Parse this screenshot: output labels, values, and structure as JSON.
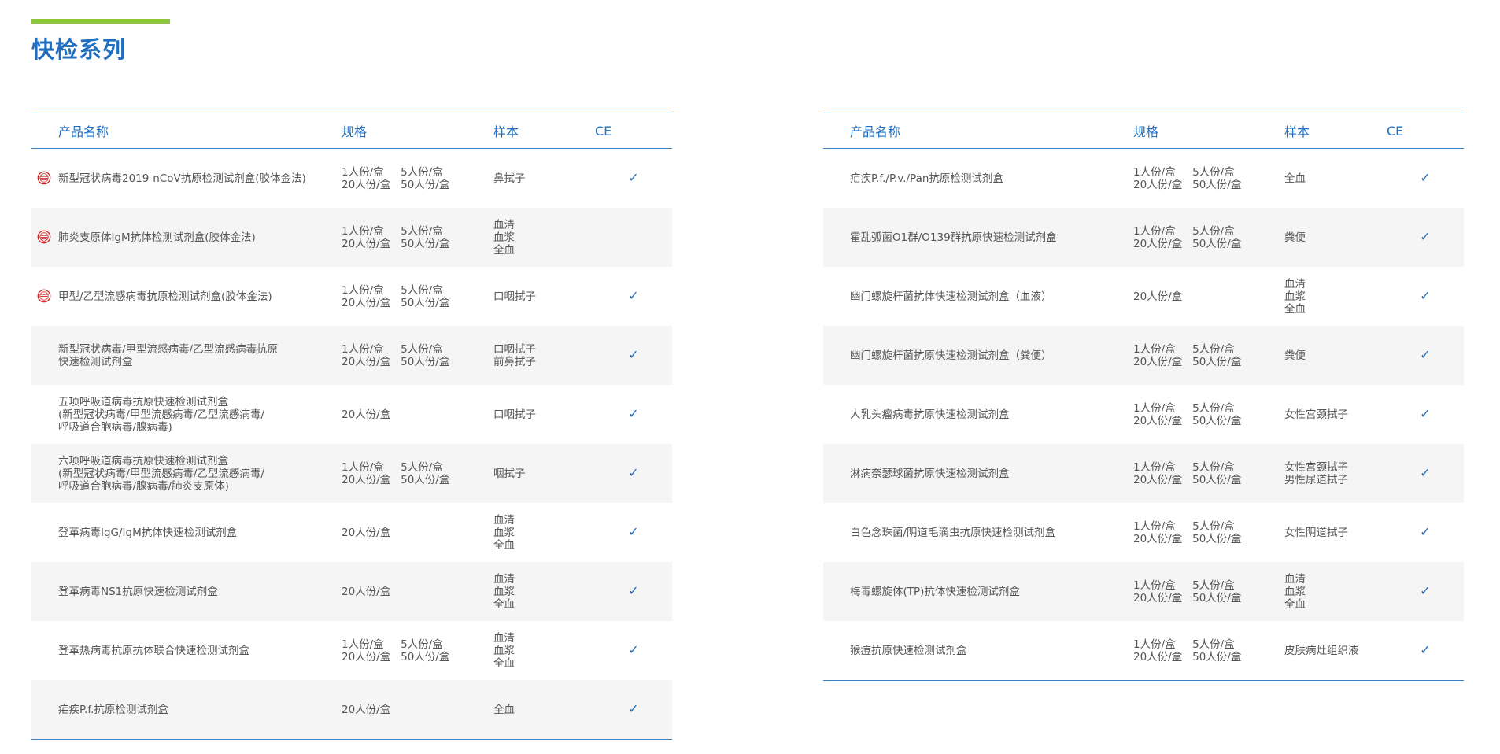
{
  "page": {
    "title": "快检系列"
  },
  "colors": {
    "accent_green": "#8cc63f",
    "accent_blue": "#1e6fc2",
    "row_alt": "#f5f5f5"
  },
  "tables": [
    {
      "headers": {
        "name": "产品名称",
        "spec": "规格",
        "sample": "样本",
        "ce": "CE"
      },
      "rows": [
        {
          "badge": true,
          "name": "新型冠状病毒2019-nCoV抗原检测试剂盒(胶体金法)",
          "spec": "1人份/盒     5人份/盒\n20人份/盒   50人份/盒",
          "sample": "鼻拭子",
          "ce": "✓"
        },
        {
          "badge": true,
          "name": "肺炎支原体IgM抗体检测试剂盒(胶体金法)",
          "spec": "1人份/盒     5人份/盒\n20人份/盒   50人份/盒",
          "sample": "血清\n血浆\n全血",
          "ce": ""
        },
        {
          "badge": true,
          "name": "甲型/乙型流感病毒抗原检测试剂盒(胶体金法)",
          "spec": "1人份/盒     5人份/盒\n20人份/盒   50人份/盒",
          "sample": "口咽拭子",
          "ce": "✓"
        },
        {
          "badge": false,
          "name": "新型冠状病毒/甲型流感病毒/乙型流感病毒抗原\n快速检测试剂盒",
          "spec": "1人份/盒     5人份/盒\n20人份/盒   50人份/盒",
          "sample": "口咽拭子\n前鼻拭子",
          "ce": "✓"
        },
        {
          "badge": false,
          "name": "五项呼吸道病毒抗原快速检测试剂盒\n(新型冠状病毒/甲型流感病毒/乙型流感病毒/\n呼吸道合胞病毒/腺病毒)",
          "spec": "20人份/盒",
          "sample": "口咽拭子",
          "ce": "✓"
        },
        {
          "badge": false,
          "name": "六项呼吸道病毒抗原快速检测试剂盒\n(新型冠状病毒/甲型流感病毒/乙型流感病毒/\n呼吸道合胞病毒/腺病毒/肺炎支原体)",
          "spec": "1人份/盒     5人份/盒\n20人份/盒   50人份/盒",
          "sample": "咽拭子",
          "ce": "✓"
        },
        {
          "badge": false,
          "name": "登革病毒IgG/IgM抗体快速检测试剂盒",
          "spec": "20人份/盒",
          "sample": "血清\n血浆\n全血",
          "ce": "✓"
        },
        {
          "badge": false,
          "name": "登革病毒NS1抗原快速检测试剂盒",
          "spec": "20人份/盒",
          "sample": "血清\n血浆\n全血",
          "ce": "✓"
        },
        {
          "badge": false,
          "name": "登革热病毒抗原抗体联合快速检测试剂盒",
          "spec": "1人份/盒     5人份/盒\n20人份/盒   50人份/盒",
          "sample": "血清\n血浆\n全血",
          "ce": "✓"
        },
        {
          "badge": false,
          "name": "疟疾P.f.抗原检测试剂盒",
          "spec": "20人份/盒",
          "sample": "全血",
          "ce": "✓"
        }
      ]
    },
    {
      "headers": {
        "name": "产品名称",
        "spec": "规格",
        "sample": "样本",
        "ce": "CE"
      },
      "rows": [
        {
          "badge": false,
          "name": "疟疾P.f./P.v./Pan抗原检测试剂盒",
          "spec": "1人份/盒     5人份/盒\n20人份/盒   50人份/盒",
          "sample": "全血",
          "ce": "✓"
        },
        {
          "badge": false,
          "name": "霍乱弧菌O1群/O139群抗原快速检测试剂盒",
          "spec": "1人份/盒     5人份/盒\n20人份/盒   50人份/盒",
          "sample": "粪便",
          "ce": "✓"
        },
        {
          "badge": false,
          "name": "幽门螺旋杆菌抗体快速检测试剂盒（血液）",
          "spec": "20人份/盒",
          "sample": "血清\n血浆\n全血",
          "ce": "✓"
        },
        {
          "badge": false,
          "name": "幽门螺旋杆菌抗原快速检测试剂盒（粪便）",
          "spec": "1人份/盒     5人份/盒\n20人份/盒   50人份/盒",
          "sample": "粪便",
          "ce": "✓"
        },
        {
          "badge": false,
          "name": "人乳头瘤病毒抗原快速检测试剂盒",
          "spec": "1人份/盒     5人份/盒\n20人份/盒   50人份/盒",
          "sample": "女性宫颈拭子",
          "ce": "✓"
        },
        {
          "badge": false,
          "name": "淋病奈瑟球菌抗原快速检测试剂盒",
          "spec": "1人份/盒     5人份/盒\n20人份/盒   50人份/盒",
          "sample": "女性宫颈拭子\n男性尿道拭子",
          "ce": "✓"
        },
        {
          "badge": false,
          "name": "白色念珠菌/阴道毛滴虫抗原快速检测试剂盒",
          "spec": "1人份/盒     5人份/盒\n20人份/盒   50人份/盒",
          "sample": "女性阴道拭子",
          "ce": "✓"
        },
        {
          "badge": false,
          "name": "梅毒螺旋体(TP)抗体快速检测试剂盒",
          "spec": "1人份/盒     5人份/盒\n20人份/盒   50人份/盒",
          "sample": "血清\n血浆\n全血",
          "ce": "✓"
        },
        {
          "badge": false,
          "name": "猴痘抗原快速检测试剂盒",
          "spec": "1人份/盒     5人份/盒\n20人份/盒   50人份/盒",
          "sample": "皮肤病灶组织液",
          "ce": "✓"
        }
      ]
    }
  ]
}
